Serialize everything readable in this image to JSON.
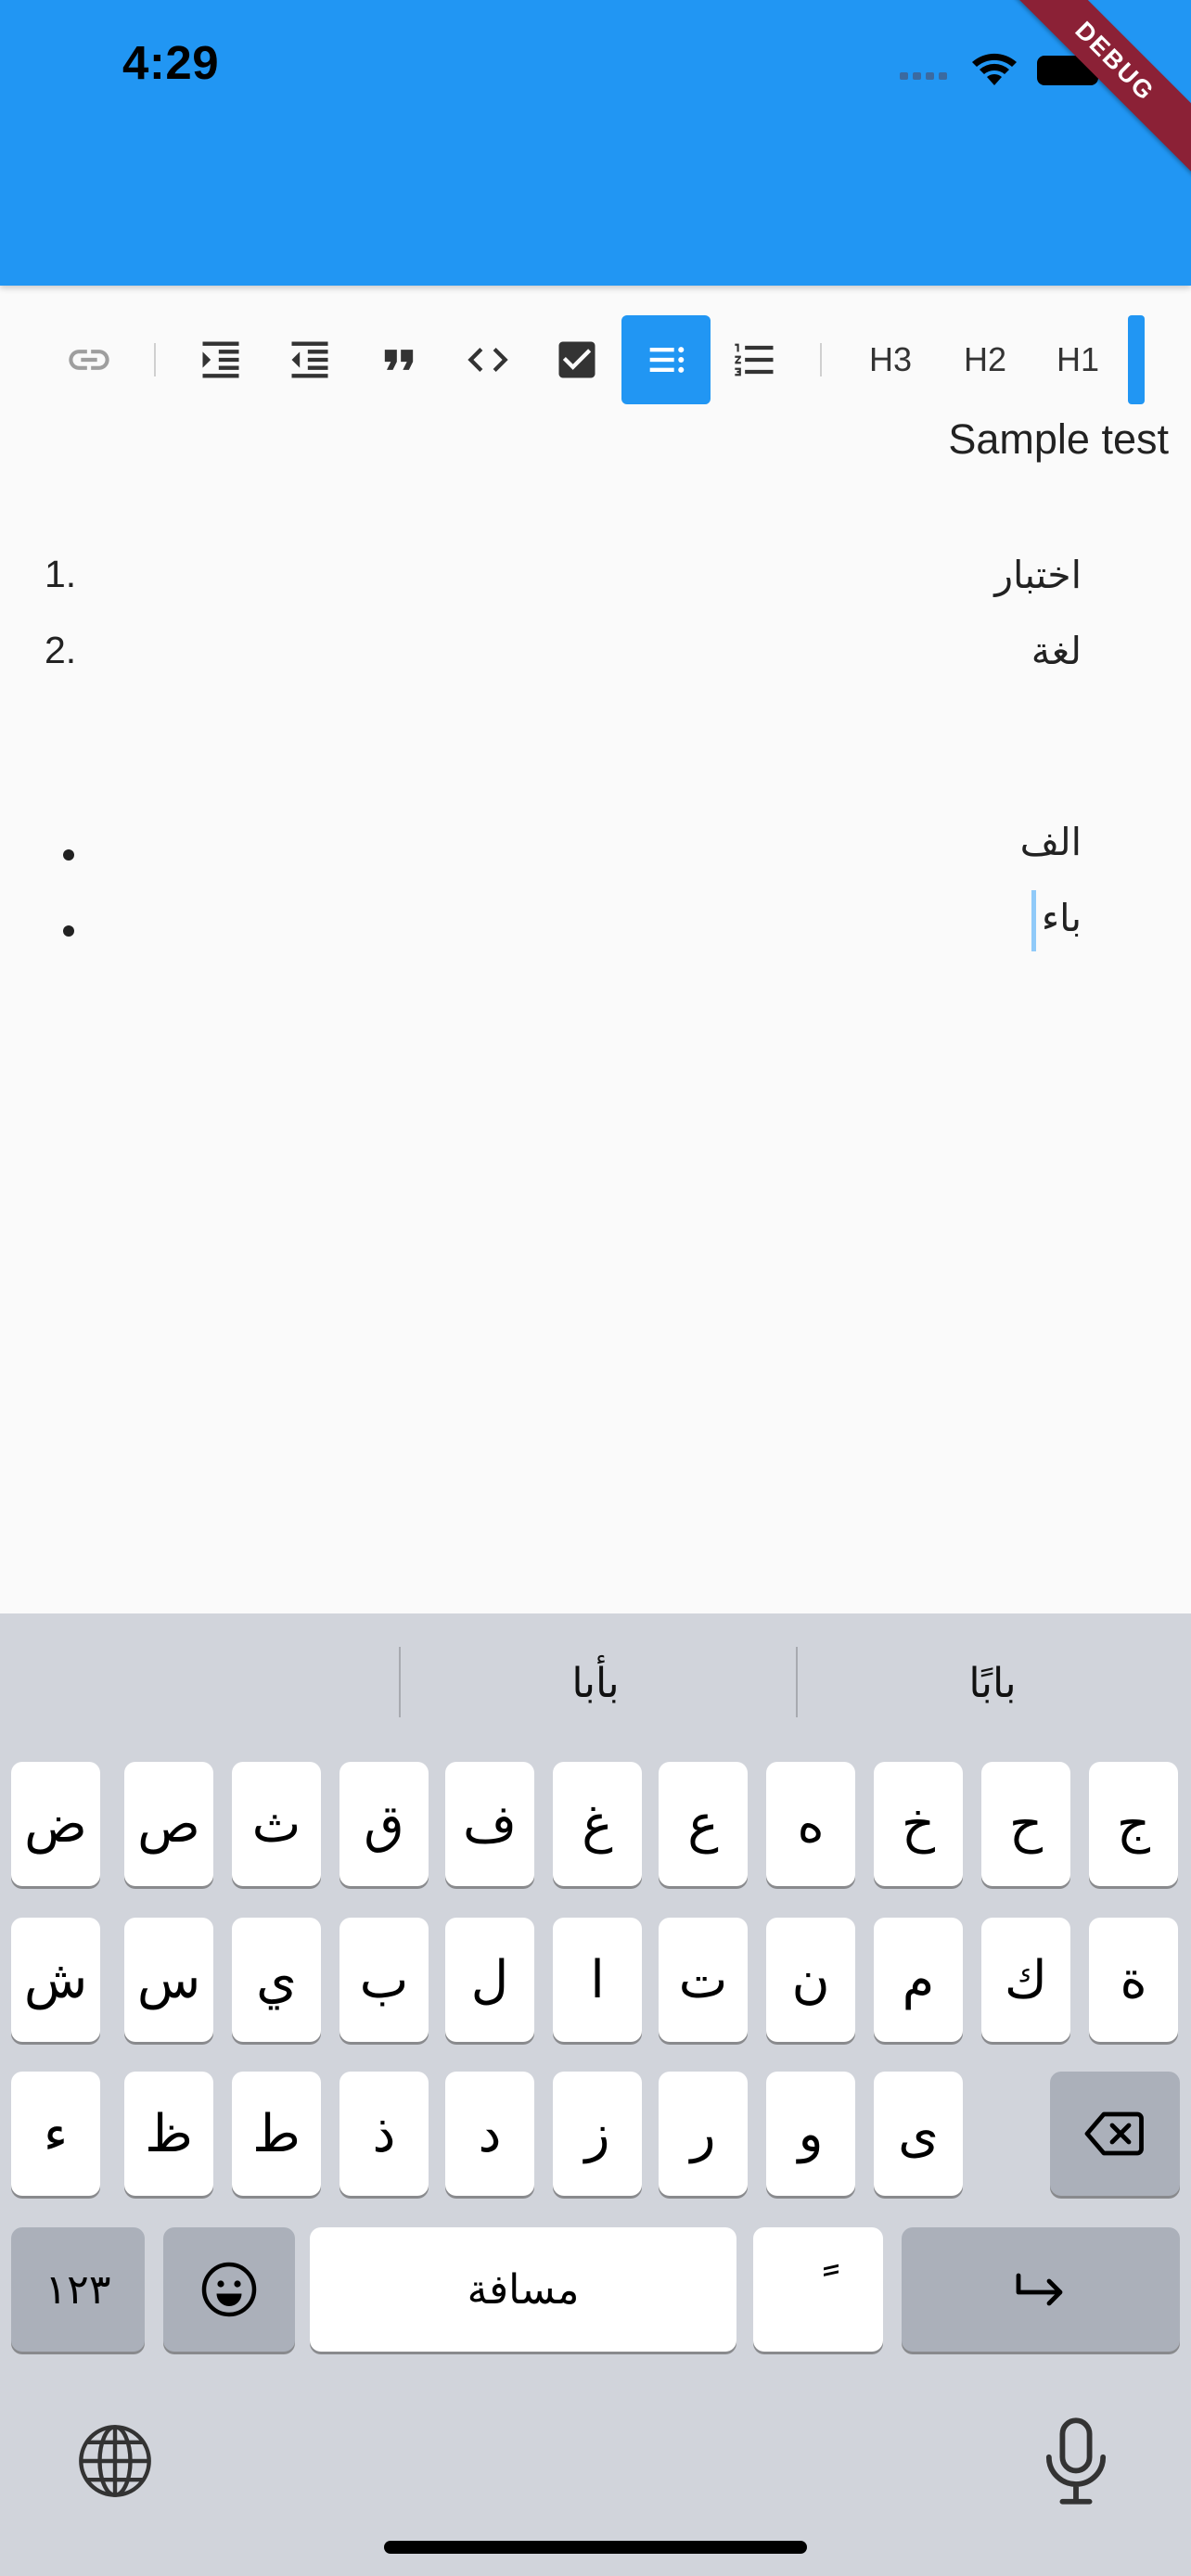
{
  "status_bar": {
    "time": "4:29",
    "debug_label": "DEBUG"
  },
  "toolbar": {
    "heading_buttons": [
      "H3",
      "H2",
      "H1"
    ],
    "active_button": "bullet-list",
    "accent_color": "#2196f3"
  },
  "editor": {
    "title": "Sample test",
    "ordered_list": [
      {
        "marker": "1.",
        "text": "اختبار"
      },
      {
        "marker": "2.",
        "text": "لغة"
      }
    ],
    "bullet_list": [
      {
        "text": "الف"
      },
      {
        "text": "باء"
      }
    ]
  },
  "keyboard": {
    "suggestions": [
      "بابًا",
      "بأبا",
      ""
    ],
    "row1": [
      "ج",
      "ح",
      "خ",
      "ه",
      "ع",
      "غ",
      "ف",
      "ق",
      "ث",
      "ص",
      "ض"
    ],
    "row2": [
      "ة",
      "ك",
      "م",
      "ن",
      "ت",
      "ا",
      "ل",
      "ب",
      "ي",
      "س",
      "ش"
    ],
    "row3": [
      "ى",
      "و",
      "ر",
      "ز",
      "د",
      "ذ",
      "ط",
      "ظ",
      "ء"
    ],
    "numbers_label": "١٢٣",
    "space_label": "مسافة",
    "diacritic_label": "ً"
  }
}
